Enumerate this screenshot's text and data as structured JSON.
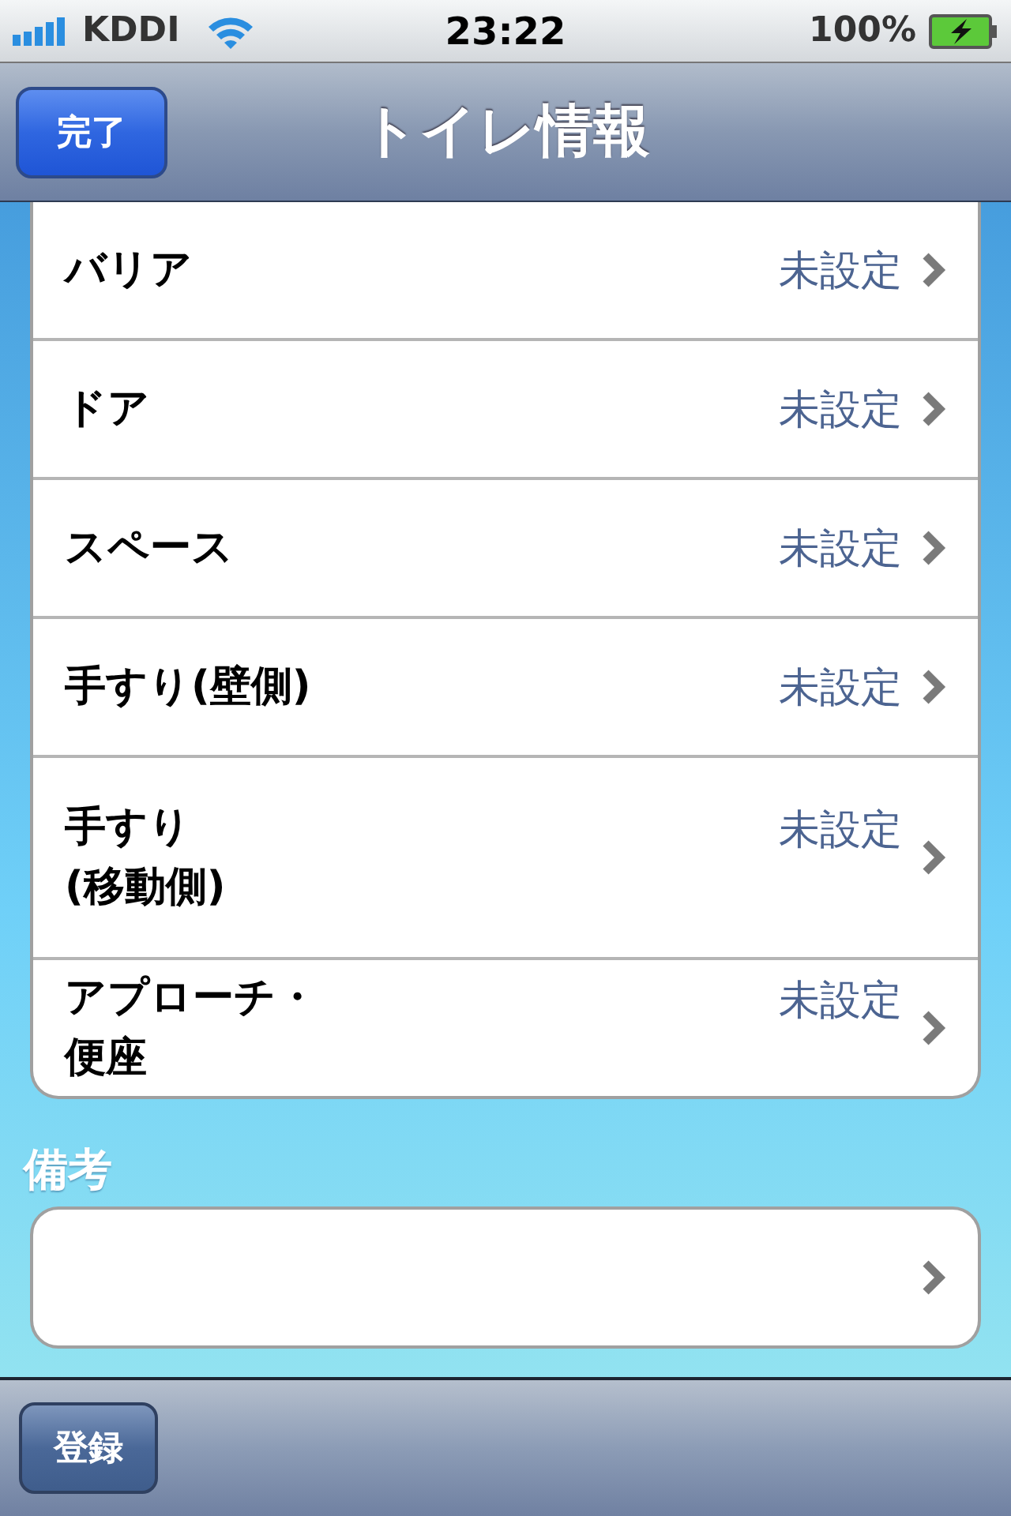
{
  "status_bar": {
    "carrier": "KDDI",
    "time": "23:22",
    "battery": "100%"
  },
  "nav_bar": {
    "done_button": "完了",
    "title": "トイレ情報"
  },
  "rows": [
    {
      "label_lines": [
        "バリア"
      ],
      "value": "未設定"
    },
    {
      "label_lines": [
        "ドア"
      ],
      "value": "未設定"
    },
    {
      "label_lines": [
        "スペース"
      ],
      "value": "未設定"
    },
    {
      "label_lines": [
        "手すり(壁側)"
      ],
      "value": "未設定"
    },
    {
      "label_lines": [
        "手すり",
        "(移動側)"
      ],
      "value": "未設定"
    },
    {
      "label_lines": [
        "アプローチ・",
        "便座"
      ],
      "value": "未設定"
    }
  ],
  "note": {
    "label": "備考"
  },
  "toolbar": {
    "register_button": "登録"
  }
}
